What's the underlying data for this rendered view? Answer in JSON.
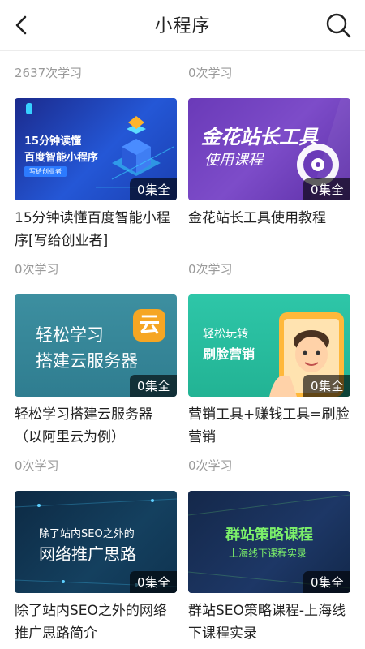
{
  "header": {
    "title": "小程序",
    "back_icon": "chevron-left-icon",
    "search_icon": "search-icon"
  },
  "top_stats": [
    "2637次学习",
    "0次学习"
  ],
  "cards": [
    {
      "thumb_lines": [
        "15分钟读懂",
        "百度智能小程序"
      ],
      "thumb_tag": "写给创业者",
      "badge": "0集全",
      "title": "15分钟读懂百度智能小程序[写给创业者]",
      "stats": "0次学习"
    },
    {
      "thumb_lines": [
        "金花站长工具",
        "使用课程"
      ],
      "badge": "0集全",
      "title": "金花站长工具使用教程",
      "stats": "0次学习"
    },
    {
      "thumb_lines": [
        "轻松学习",
        "搭建云服务器"
      ],
      "thumb_icon_char": "云",
      "badge": "0集全",
      "title": "轻松学习搭建云服务器（以阿里云为例）",
      "stats": "0次学习"
    },
    {
      "thumb_lines": [
        "轻松玩转",
        "刷脸营销"
      ],
      "badge": "0集全",
      "title": "营销工具+赚钱工具=刷脸营销",
      "stats": "0次学习"
    },
    {
      "thumb_lines": [
        "除了站内SEO之外的",
        "网络推广思路"
      ],
      "badge": "0集全",
      "title": "除了站内SEO之外的网络推广思路简介",
      "stats": ""
    },
    {
      "thumb_lines": [
        "群站策略课程",
        "上海线下课程实录"
      ],
      "badge": "0集全",
      "title": "群站SEO策略课程-上海线下课程实录",
      "stats": ""
    }
  ]
}
